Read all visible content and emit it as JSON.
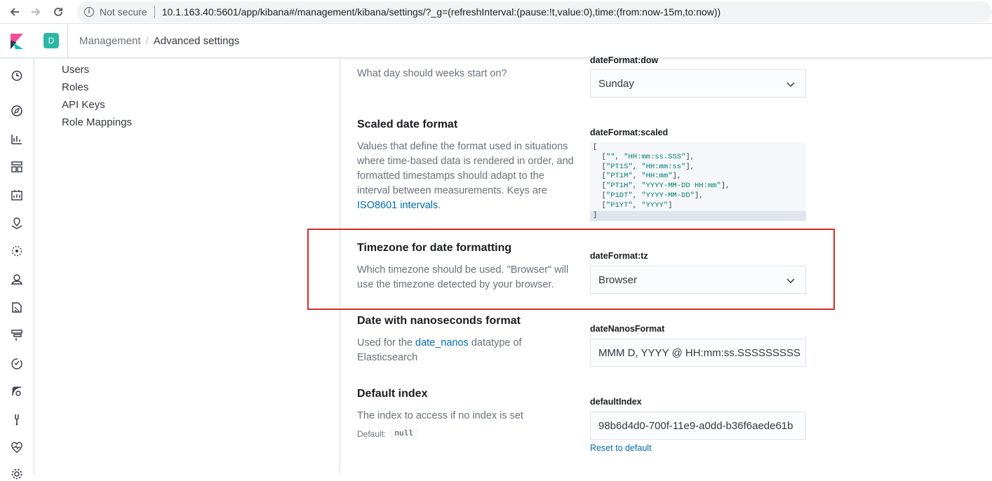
{
  "browser": {
    "security_label": "Not secure",
    "url": "10.1.163.40:5601/app/kibana#/management/kibana/settings/?_g=(refreshInterval:(pause:!t,value:0),time:(from:now-15m,to:now))"
  },
  "header": {
    "space_initial": "D",
    "breadcrumbs": [
      "Management",
      "Advanced settings"
    ]
  },
  "side_nav": {
    "icons": [
      "clock-icon",
      "compass-icon",
      "visualize-icon",
      "dashboard-icon",
      "canvas-icon",
      "maps-icon",
      "ml-icon",
      "infra-icon",
      "logs-icon",
      "apm-icon",
      "uptime-icon",
      "siem-icon",
      "devtools-icon",
      "monitoring-icon",
      "gear-icon"
    ]
  },
  "mgmt_links": [
    "Users",
    "Roles",
    "API Keys",
    "Role Mappings"
  ],
  "settings": {
    "dow": {
      "desc": "What day should weeks start on?",
      "key": "dateFormat:dow",
      "value": "Sunday"
    },
    "scaled": {
      "title": "Scaled date format",
      "desc_before": "Values that define the format used in situations where time-based data is rendered in order, and formatted timestamps should adapt to the interval between measurements. Keys are ",
      "desc_link": "ISO8601 intervals",
      "desc_after": ".",
      "key": "dateFormat:scaled",
      "code_lines": [
        [
          "",
          "HH:mm:ss.SSS"
        ],
        [
          "PT1S",
          "HH:mm:ss"
        ],
        [
          "PT1M",
          "HH:mm"
        ],
        [
          "PT1H",
          "YYYY-MM-DD HH:mm"
        ],
        [
          "P1DT",
          "YYYY-MM-DD"
        ],
        [
          "P1YT",
          "YYYY"
        ]
      ]
    },
    "tz": {
      "title": "Timezone for date formatting",
      "desc": "Which timezone should be used. \"Browser\" will use the timezone detected by your browser.",
      "key": "dateFormat:tz",
      "value": "Browser"
    },
    "nanos": {
      "title": "Date with nanoseconds format",
      "desc_before": "Used for the ",
      "desc_link": "date_nanos",
      "desc_after": " datatype of Elasticsearch",
      "key": "dateNanosFormat",
      "value": "MMM D, YYYY @ HH:mm:ss.SSSSSSSSS"
    },
    "default_index": {
      "title": "Default index",
      "desc": "The index to access if no index is set",
      "default_label": "Default:",
      "default_value": "null",
      "key": "defaultIndex",
      "value": "98b6d4d0-700f-11e9-a0dd-b36f6aede61b",
      "reset_label": "Reset to default"
    }
  }
}
